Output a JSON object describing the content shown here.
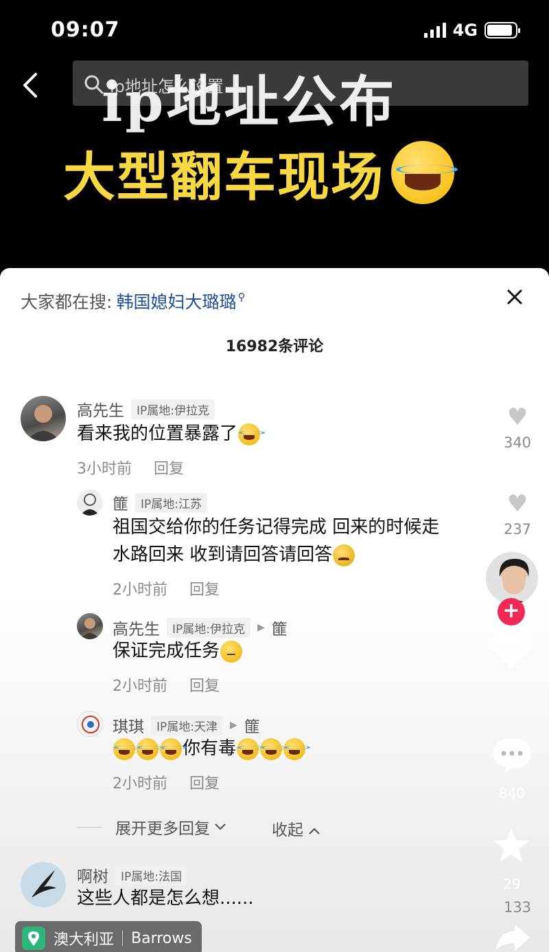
{
  "status_bar": {
    "time": "09:07",
    "network": "4G",
    "signal_bars": 4,
    "battery_level": 0.9
  },
  "top": {
    "search_placeholder": "ip地址怎么设置",
    "overlay_title": "ip地址公布",
    "overlay_subtitle": "大型翻车现场",
    "icons": [
      "back-icon",
      "search-icon",
      "laughing-emoji-icon"
    ]
  },
  "comments_panel": {
    "hot_label": "大家都在搜:",
    "hot_term": "韩国媳妇大璐璐",
    "count_text": "16982条评论",
    "comments": [
      {
        "name": "高先生",
        "ip": "IP属地:伊拉克",
        "text": "看来我的位置暴露了",
        "emojis": [
          "cry-laugh"
        ],
        "time": "3小时前",
        "reply": "回复",
        "likes": "340"
      },
      {
        "name": "篚",
        "ip": "IP属地:江苏",
        "text_line1": "祖国交给你的任务记得完成  回来的时候走",
        "text_line2": "水路回来  收到请回答请回答",
        "emojis": [
          "sad"
        ],
        "time": "2小时前",
        "reply": "回复",
        "likes": "237"
      },
      {
        "name": "高先生",
        "ip": "IP属地:伊拉克",
        "reply_to": "篚",
        "text": "保证完成任务",
        "emojis": [
          "thinking"
        ],
        "time": "2小时前",
        "reply": "回复"
      },
      {
        "name": "琪琪",
        "ip": "IP属地:天津",
        "reply_to": "篚",
        "text": "你有毒",
        "emojis_before": [
          "cry-laugh",
          "cry-laugh",
          "cry-laugh"
        ],
        "emojis_after": [
          "cry",
          "cry",
          "cry"
        ],
        "time": "2小时前",
        "reply": "回复"
      },
      {
        "name": "啊树",
        "ip": "IP属地:法国",
        "text": "这些人都是怎么想......",
        "likes": "133"
      }
    ],
    "expand_label": "展开更多回复",
    "collapse_label": "收起"
  },
  "side_actions": {
    "comment_count": "840",
    "favorite_count": "29",
    "follow_symbol": "+",
    "icons": [
      "heart-icon",
      "comment-icon",
      "star-icon",
      "share-icon"
    ]
  },
  "location": {
    "country": "澳大利亚",
    "city": "Barrows"
  },
  "colors": {
    "background": "#000000",
    "accent_yellow": "#f7d842",
    "link_blue": "#1f4e96",
    "follow_red": "#ee2a55",
    "location_green": "#2db67a"
  }
}
